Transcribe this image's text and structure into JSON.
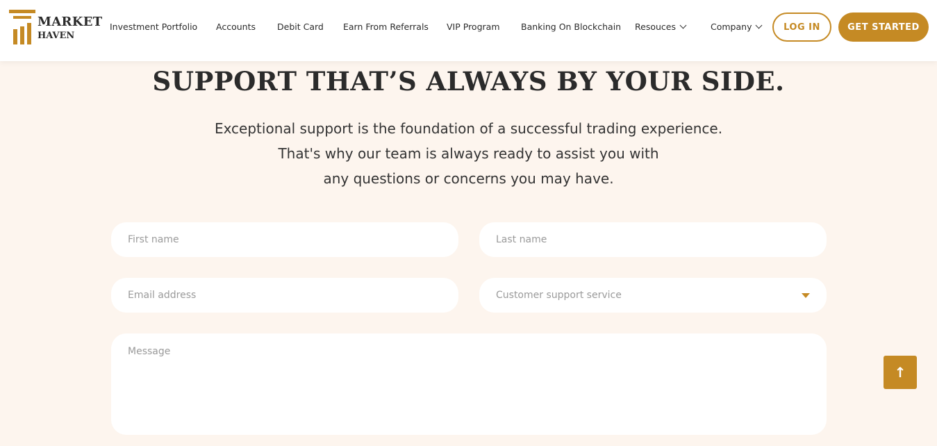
{
  "brand": {
    "line1": "MARKET",
    "line2": "HAVEN"
  },
  "nav": [
    "Investment Portfolio",
    "Accounts",
    "Debit Card",
    "Earn From Referrals",
    "VIP Program",
    "Banking On Blockchain",
    "Resouces",
    "Company"
  ],
  "buttons": {
    "login": "LOG IN",
    "get_started": "GET STARTED"
  },
  "hero": {
    "title": "SUPPORT THAT’S ALWAYS BY YOUR SIDE.",
    "lines": [
      "Exceptional support is the foundation of a successful trading experience.",
      "That's why our team is always ready to assist you with",
      "any questions or concerns you may have."
    ]
  },
  "form": {
    "first_name": "First name",
    "last_name": "Last name",
    "email": "Email address",
    "service": "Customer support service",
    "message": "Message"
  },
  "colors": {
    "accent": "#c58a24",
    "background": "#fdf5ee"
  },
  "scroll_top_icon": "↑"
}
